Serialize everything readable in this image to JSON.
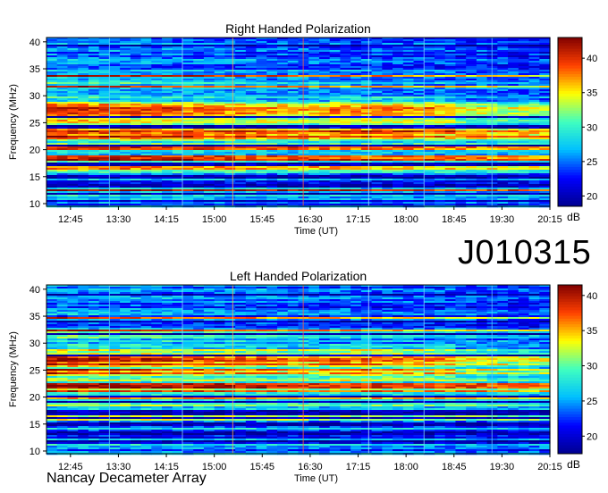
{
  "observation_id": "J010315",
  "credit": "Nancay Decameter Array",
  "chart_data": [
    {
      "type": "heatmap",
      "title": "Right Handed Polarization",
      "xlabel": "Time (UT)",
      "ylabel": "Frequency (MHz)",
      "x_ticks": [
        "12:45",
        "13:30",
        "14:15",
        "15:00",
        "15:45",
        "16:30",
        "17:15",
        "18:00",
        "18:45",
        "19:30",
        "20:15"
      ],
      "y_ticks": [
        10,
        15,
        20,
        25,
        30,
        35,
        40
      ],
      "ylim": [
        9.5,
        40.8
      ],
      "x_range": [
        "12:30",
        "20:15"
      ],
      "colorbar": {
        "label": "dB",
        "ticks": [
          20,
          25,
          30,
          35,
          40
        ],
        "range": [
          18.5,
          43
        ]
      },
      "colormap": [
        "#00008f",
        "#0000ff",
        "#00c0ff",
        "#40ffbf",
        "#ffff00",
        "#ff4000",
        "#800000"
      ],
      "strong_bands_mhz": [
        [
          26,
          28.5
        ],
        [
          22,
          23.5
        ],
        [
          20,
          21
        ],
        [
          18,
          18.8
        ],
        [
          16.3,
          16.8
        ]
      ],
      "dark_bands_mhz": [
        [
          13,
          13.5
        ],
        [
          14.5,
          15.2
        ],
        [
          11.6,
          12.1
        ],
        [
          17.1,
          17.5
        ],
        [
          24,
          24.5
        ]
      ]
    },
    {
      "type": "heatmap",
      "title": "Left Handed Polarization",
      "xlabel": "Time (UT)",
      "ylabel": "Frequency (MHz)",
      "x_ticks": [
        "12:45",
        "13:30",
        "14:15",
        "15:00",
        "15:45",
        "16:30",
        "17:15",
        "18:00",
        "18:45",
        "19:30",
        "20:15"
      ],
      "y_ticks": [
        10,
        15,
        20,
        25,
        30,
        35,
        40
      ],
      "ylim": [
        9.5,
        40.8
      ],
      "x_range": [
        "12:30",
        "20:15"
      ],
      "colorbar": {
        "label": "dB",
        "ticks": [
          20,
          25,
          30,
          35,
          40
        ],
        "range": [
          17.5,
          41.5
        ]
      },
      "colormap": [
        "#00008f",
        "#0000ff",
        "#00c0ff",
        "#40ffbf",
        "#ffff00",
        "#ff4000",
        "#800000"
      ],
      "strong_bands_mhz": [
        [
          26,
          28
        ],
        [
          21.5,
          22.5
        ],
        [
          19.5,
          20.3
        ]
      ],
      "dark_bands_mhz": [
        [
          13,
          13.5
        ],
        [
          14.5,
          15.2
        ],
        [
          11.6,
          12.1
        ],
        [
          17.1,
          17.5
        ]
      ]
    }
  ]
}
